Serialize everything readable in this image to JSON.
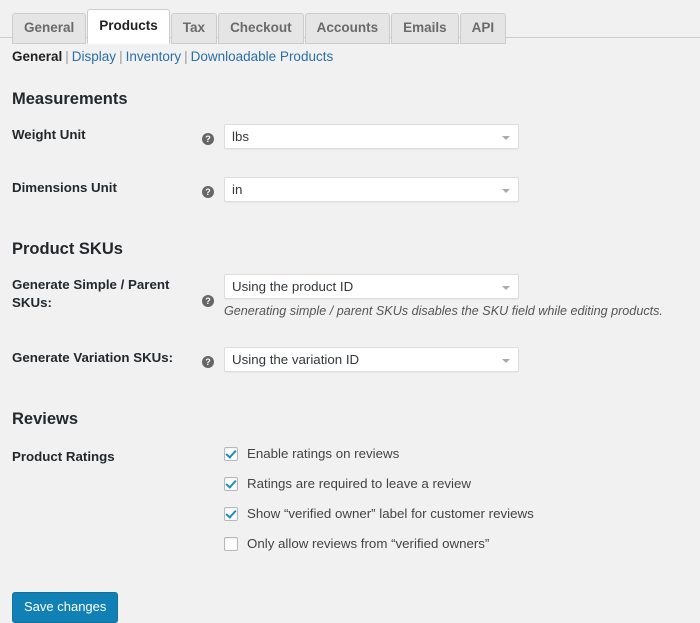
{
  "tabs": [
    {
      "label": "General",
      "active": false
    },
    {
      "label": "Products",
      "active": true
    },
    {
      "label": "Tax",
      "active": false
    },
    {
      "label": "Checkout",
      "active": false
    },
    {
      "label": "Accounts",
      "active": false
    },
    {
      "label": "Emails",
      "active": false
    },
    {
      "label": "API",
      "active": false
    }
  ],
  "subnav": {
    "items": [
      {
        "label": "General",
        "active": true
      },
      {
        "label": "Display",
        "active": false
      },
      {
        "label": "Inventory",
        "active": false
      },
      {
        "label": "Downloadable Products",
        "active": false
      }
    ],
    "separator": "|"
  },
  "sections": {
    "measurements": {
      "title": "Measurements",
      "rows": [
        {
          "label": "Weight Unit",
          "help": "?",
          "value": "lbs",
          "description": ""
        },
        {
          "label": "Dimensions Unit",
          "help": "?",
          "value": "in",
          "description": ""
        }
      ]
    },
    "product_skus": {
      "title": "Product SKUs",
      "rows": [
        {
          "label": "Generate Simple / Parent SKUs:",
          "help": "?",
          "value": "Using the product ID",
          "description": "Generating simple / parent SKUs disables the SKU field while editing products."
        },
        {
          "label": "Generate Variation SKUs:",
          "help": "?",
          "value": "Using the variation ID",
          "description": ""
        }
      ]
    },
    "reviews": {
      "title": "Reviews",
      "row_label": "Product Ratings",
      "checkboxes": [
        {
          "label": "Enable ratings on reviews",
          "checked": true
        },
        {
          "label": "Ratings are required to leave a review",
          "checked": true
        },
        {
          "label": "Show “verified owner” label for customer reviews",
          "checked": true
        },
        {
          "label": "Only allow reviews from “verified owners”",
          "checked": false
        }
      ]
    }
  },
  "footer": {
    "save_label": "Save changes"
  },
  "colors": {
    "page_background": "#f1f1f1",
    "accent_blue": "#1180b5",
    "link_blue": "#2a6fa8",
    "checkbox_check": "#1e8cbe",
    "tab_inactive": "#e5e5e5",
    "border": "#cccccc"
  }
}
